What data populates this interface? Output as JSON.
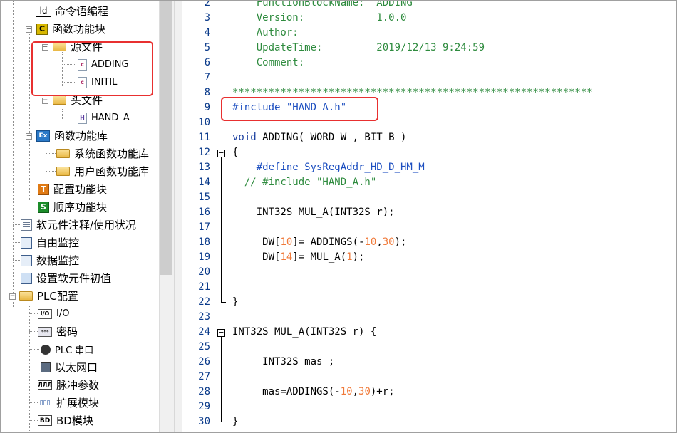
{
  "tree": {
    "items": [
      {
        "label": "命令语编程",
        "icon": "ld-icon",
        "icon_text": "ld"
      },
      {
        "label": "函数功能块",
        "icon": "function-block-icon",
        "icon_text": "C",
        "toggle": "−"
      },
      {
        "label": "源文件",
        "icon": "folder-icon",
        "toggle": "−"
      },
      {
        "label": "ADDING",
        "icon": "source-file-icon",
        "icon_text": "c"
      },
      {
        "label": "INITIL",
        "icon": "source-file-icon",
        "icon_text": "c"
      },
      {
        "label": "头文件",
        "icon": "folder-icon",
        "toggle": "−"
      },
      {
        "label": "HAND_A",
        "icon": "header-file-icon",
        "icon_text": "H"
      },
      {
        "label": "函数功能库",
        "icon": "library-icon",
        "icon_text": "Ex",
        "toggle": "−"
      },
      {
        "label": "系统函数功能库",
        "icon": "folder-icon"
      },
      {
        "label": "用户函数功能库",
        "icon": "folder-icon"
      },
      {
        "label": "配置功能块",
        "icon": "config-block-icon",
        "icon_text": "T"
      },
      {
        "label": "顺序功能块",
        "icon": "sequence-block-icon",
        "icon_text": "S"
      },
      {
        "label": "软元件注释/使用状况",
        "icon": "comment-list-icon"
      },
      {
        "label": "自由监控",
        "icon": "free-monitor-icon"
      },
      {
        "label": "数据监控",
        "icon": "data-monitor-icon"
      },
      {
        "label": "设置软元件初值",
        "icon": "init-value-icon"
      },
      {
        "label": "PLC配置",
        "icon": "folder-icon",
        "toggle": "−"
      },
      {
        "label": "I/O",
        "icon": "io-icon",
        "icon_text": "I/O"
      },
      {
        "label": "密码",
        "icon": "password-icon",
        "icon_text": "***"
      },
      {
        "label": "PLC 串口",
        "icon": "serial-port-icon"
      },
      {
        "label": "以太网口",
        "icon": "ethernet-icon"
      },
      {
        "label": "脉冲参数",
        "icon": "pulse-icon",
        "icon_text": "ЛЛЛ"
      },
      {
        "label": "扩展模块",
        "icon": "expansion-module-icon",
        "icon_text": "▯▯▯"
      },
      {
        "label": "BD模块",
        "icon": "bd-module-icon",
        "icon_text": "BD"
      }
    ]
  },
  "editor": {
    "line_numbers": [
      "2",
      "3",
      "4",
      "5",
      "6",
      "7",
      "8",
      "9",
      "10",
      "11",
      "12",
      "13",
      "14",
      "15",
      "16",
      "17",
      "18",
      "19",
      "20",
      "21",
      "22",
      "23",
      "24",
      "25",
      "26",
      "27",
      "28",
      "29",
      "30"
    ],
    "lines": {
      "l2": "    FunctionBlockName:  ADDING",
      "l3": "    Version:            1.0.0",
      "l4": "    Author:",
      "l5": "    UpdateTime:         2019/12/13 9:24:59",
      "l6": "    Comment:",
      "l8": "************************************************************",
      "l9": "#include \"HAND_A.h\"",
      "l11a": "void",
      "l11b": " ADDING( WORD W , BIT B )",
      "l12": "{",
      "l13": "    #define SysRegAddr_HD_D_HM_M",
      "l14": "  // #include \"HAND_A.h\"",
      "l16": "    INT32S MUL_A(INT32S r);",
      "l18a": "     DW[",
      "l18b": "10",
      "l18c": "]= ADDINGS(-",
      "l18d": "10",
      "l18e": ",",
      "l18f": "30",
      "l18g": ");",
      "l19a": "     DW[",
      "l19b": "14",
      "l19c": "]= MUL_A(",
      "l19d": "1",
      "l19e": ");",
      "l22": "}",
      "l24": "INT32S MUL_A(INT32S r) {",
      "l26": "     INT32S mas ;",
      "l28a": "     mas=ADDINGS(-",
      "l28b": "10",
      "l28c": ",",
      "l28d": "30",
      "l28e": ")+r;",
      "l30": "}"
    },
    "fold_markers": {
      "collapse": "−"
    }
  },
  "colors": {
    "highlight_box": "#e83030",
    "comment": "#2e8b3e",
    "number": "#f07a3a",
    "line_number": "#0a3a8a"
  }
}
